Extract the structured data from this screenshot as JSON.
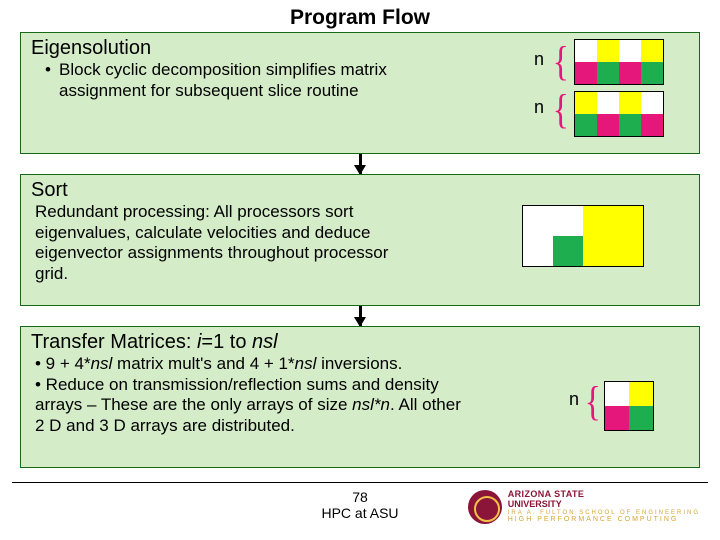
{
  "title": "Program Flow",
  "box1": {
    "heading": "Eigensolution",
    "bullet": "• ",
    "body": "Block cyclic decomposition simplifies matrix assignment for subsequent slice routine",
    "n1": "n",
    "n2": "n"
  },
  "box2": {
    "heading": "Sort",
    "body": "Redundant processing: All processors sort eigenvalues, calculate velocities and deduce eigenvector assignments throughout processor grid."
  },
  "box3": {
    "heading_pre": "Transfer Matrices: ",
    "heading_i": "i",
    "heading_mid": "=1 to ",
    "heading_nsl": "nsl",
    "b1a": "• 9 + 4*",
    "b1nsl": "nsl",
    "b1b": " matrix mult's and 4 + 1*",
    "b1nsl2": "nsl",
    "b1c": " inversions.",
    "b2": "• Reduce on transmission/reflection sums and density arrays – These are the only arrays of size ",
    "b2nsl": "nsl*n",
    "b2b": ".  All other 2 D and 3 D arrays are distributed.",
    "n": "n"
  },
  "footer": {
    "page": "78",
    "text": "HPC at ASU"
  },
  "logo": {
    "line1": "ARIZONA STATE",
    "line2": "UNIVERSITY",
    "line3": "IRA A. FULTON SCHOOL OF ENGINEERING",
    "line4": "HIGH PERFORMANCE COMPUTING"
  }
}
